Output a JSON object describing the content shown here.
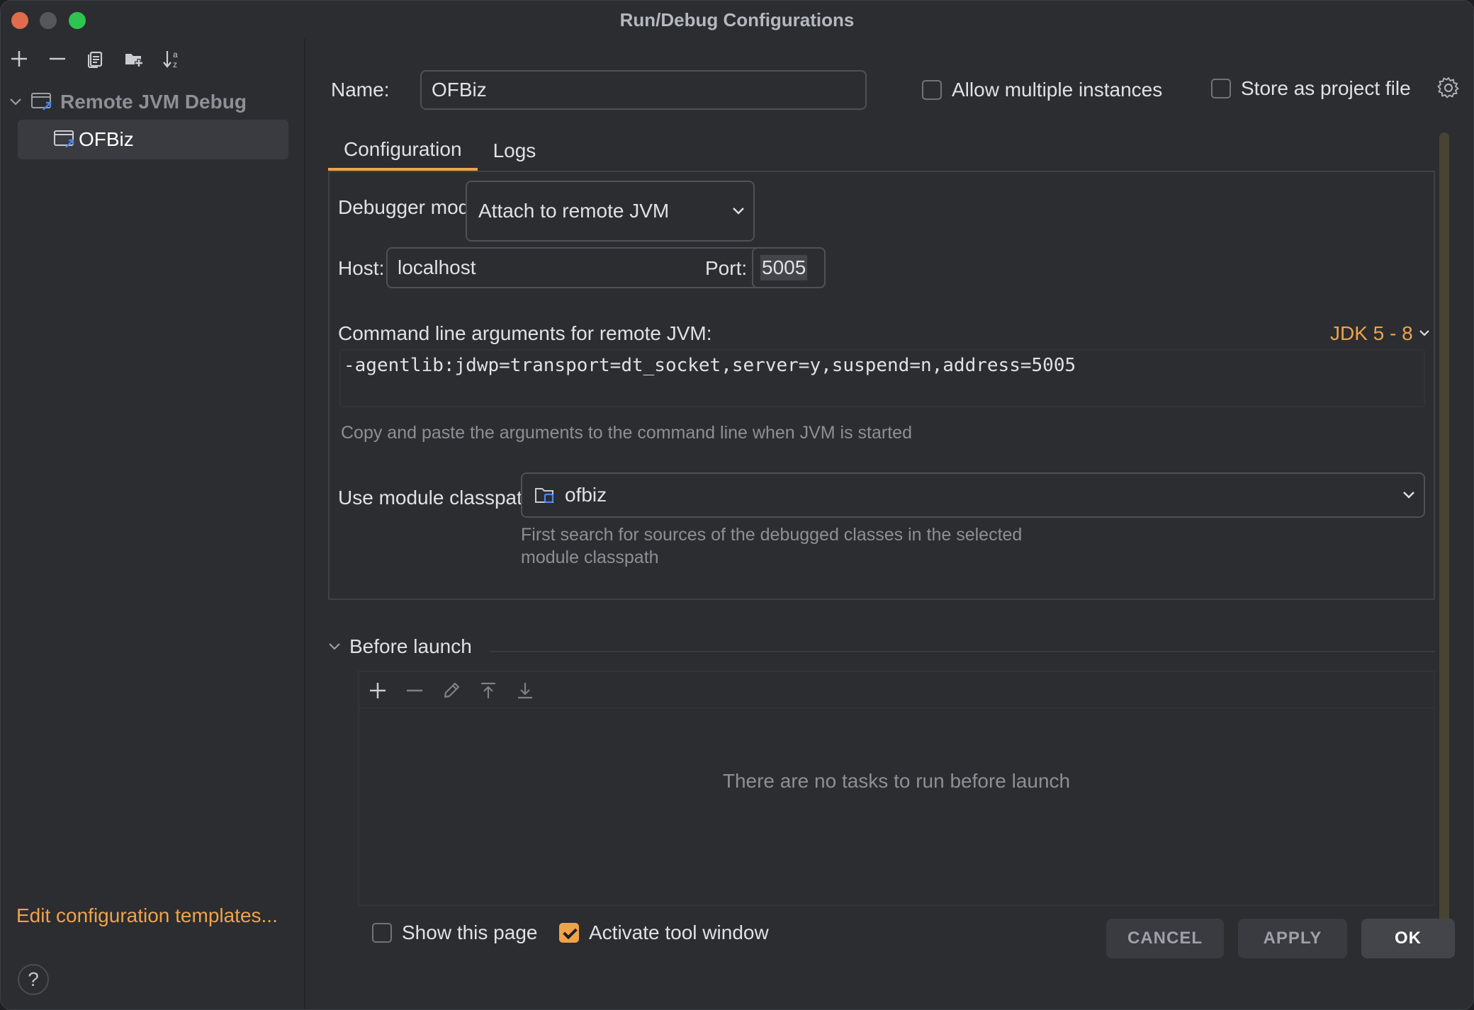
{
  "window": {
    "title": "Run/Debug Configurations"
  },
  "sidebar": {
    "toolbar": [
      "plus-icon",
      "minus-icon",
      "copy-icon",
      "new-folder-icon",
      "sort-alpha-icon"
    ],
    "group_label": "Remote JVM Debug",
    "item_label": "OFBiz",
    "edit_templates": "Edit configuration templates...",
    "help": "?"
  },
  "main": {
    "name_label": "Name:",
    "name_value": "OFBiz",
    "allow_multiple": {
      "label": "Allow multiple instances",
      "checked": false
    },
    "store_project": {
      "label": "Store as project file",
      "checked": false
    },
    "tabs": [
      {
        "label": "Configuration",
        "active": true
      },
      {
        "label": "Logs",
        "active": false
      }
    ],
    "config": {
      "debugger_mode_label": "Debugger mode:",
      "debugger_mode_value": "Attach to remote JVM",
      "host_label": "Host:",
      "host_value": "localhost",
      "port_label": "Port:",
      "port_value": "5005",
      "cmd_label": "Command line arguments for remote JVM:",
      "jdk_label": "JDK 5 - 8",
      "cmd_value": "-agentlib:jdwp=transport=dt_socket,server=y,suspend=n,address=5005",
      "cmd_hint": "Copy and paste the arguments to the command line when JVM is started",
      "classpath_label": "Use module classpath:",
      "classpath_value": "ofbiz",
      "classpath_hint_1": "First search for sources of the debugged classes in the selected",
      "classpath_hint_2": "module classpath"
    },
    "before_launch": {
      "label": "Before launch",
      "toolbar": [
        "plus-icon",
        "minus-icon",
        "edit-icon",
        "move-up-icon",
        "move-down-icon"
      ],
      "empty_text": "There are no tasks to run before launch"
    },
    "show_page": {
      "label": "Show this page",
      "checked": false
    },
    "activate_tool": {
      "label": "Activate tool window",
      "checked": true
    }
  },
  "buttons": {
    "cancel": "CANCEL",
    "apply": "APPLY",
    "ok": "OK"
  },
  "colors": {
    "accent": "#f0a24b",
    "background": "#2b2d30",
    "text": "#dfe1e5",
    "muted": "#8c9096"
  }
}
